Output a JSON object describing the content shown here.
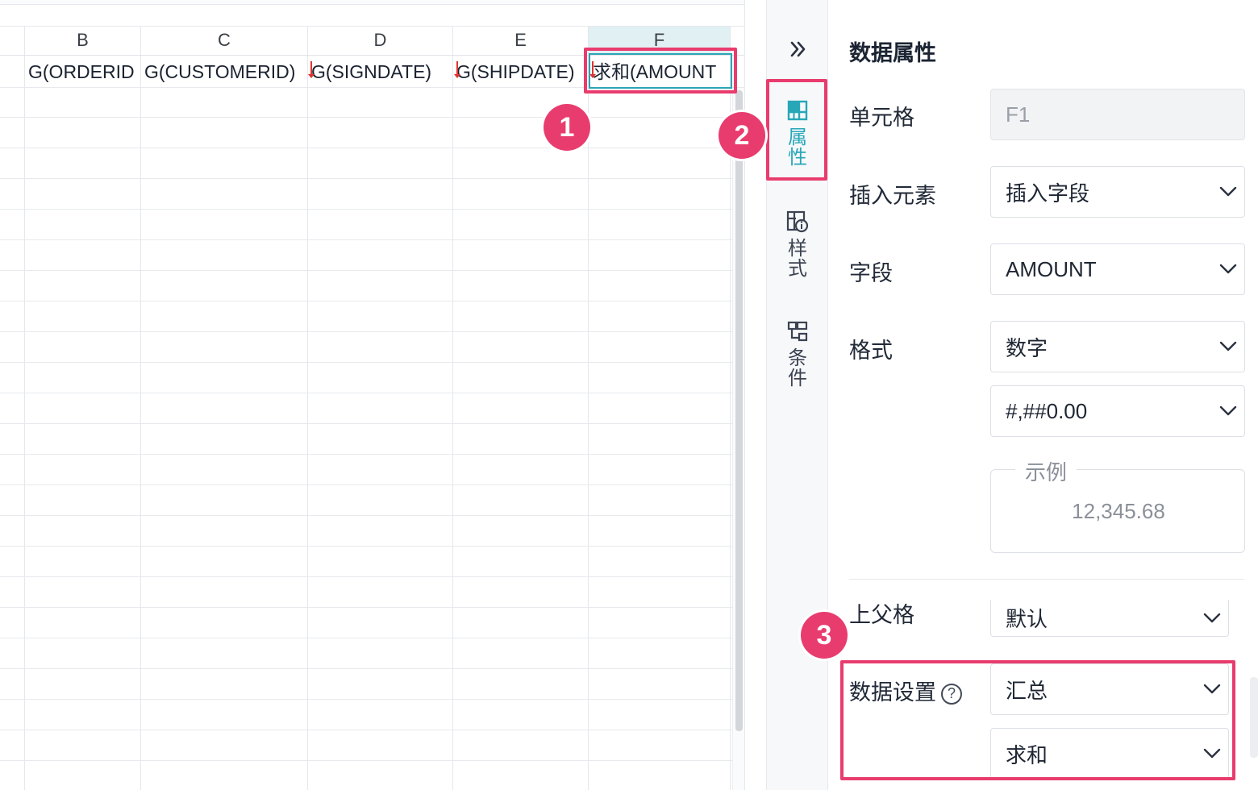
{
  "sheet": {
    "columns": [
      {
        "letter": "B",
        "cell": "G(ORDERID"
      },
      {
        "letter": "C",
        "cell": "G(CUSTOMERID)"
      },
      {
        "letter": "D",
        "cell": "G(SIGNDATE)"
      },
      {
        "letter": "E",
        "cell": "G(SHIPDATE)"
      },
      {
        "letter": "F",
        "cell": "求和(AMOUNT"
      }
    ],
    "selected_column": "F",
    "selection_color": "#2ba5b5",
    "marker_color": "#e0342f"
  },
  "annotations": {
    "color": "#e93c6e",
    "badges": [
      "1",
      "2",
      "3"
    ]
  },
  "tool_rail": {
    "collapse_icon": "double-chevron-right-icon",
    "tabs": [
      {
        "label": "属性",
        "icon": "table-cell-icon",
        "active": true
      },
      {
        "label": "样式",
        "icon": "style-info-icon",
        "active": false
      },
      {
        "label": "条件",
        "icon": "condition-icon",
        "active": false
      }
    ],
    "active_color": "#27a7b8"
  },
  "panel": {
    "title": "数据属性",
    "cell": {
      "label": "单元格",
      "value": "F1"
    },
    "insert_element": {
      "label": "插入元素",
      "value": "插入字段"
    },
    "field": {
      "label": "字段",
      "value": "AMOUNT"
    },
    "format": {
      "label": "格式",
      "value": "数字",
      "pattern": "#,##0.00"
    },
    "sample": {
      "legend": "示例",
      "value": "12,345.68"
    },
    "parent_cell": {
      "label": "上父格",
      "value": "默认"
    },
    "data_setting": {
      "label": "数据设置",
      "help_icon": "question-circle-icon",
      "value": "汇总",
      "aggregate": "求和"
    }
  }
}
